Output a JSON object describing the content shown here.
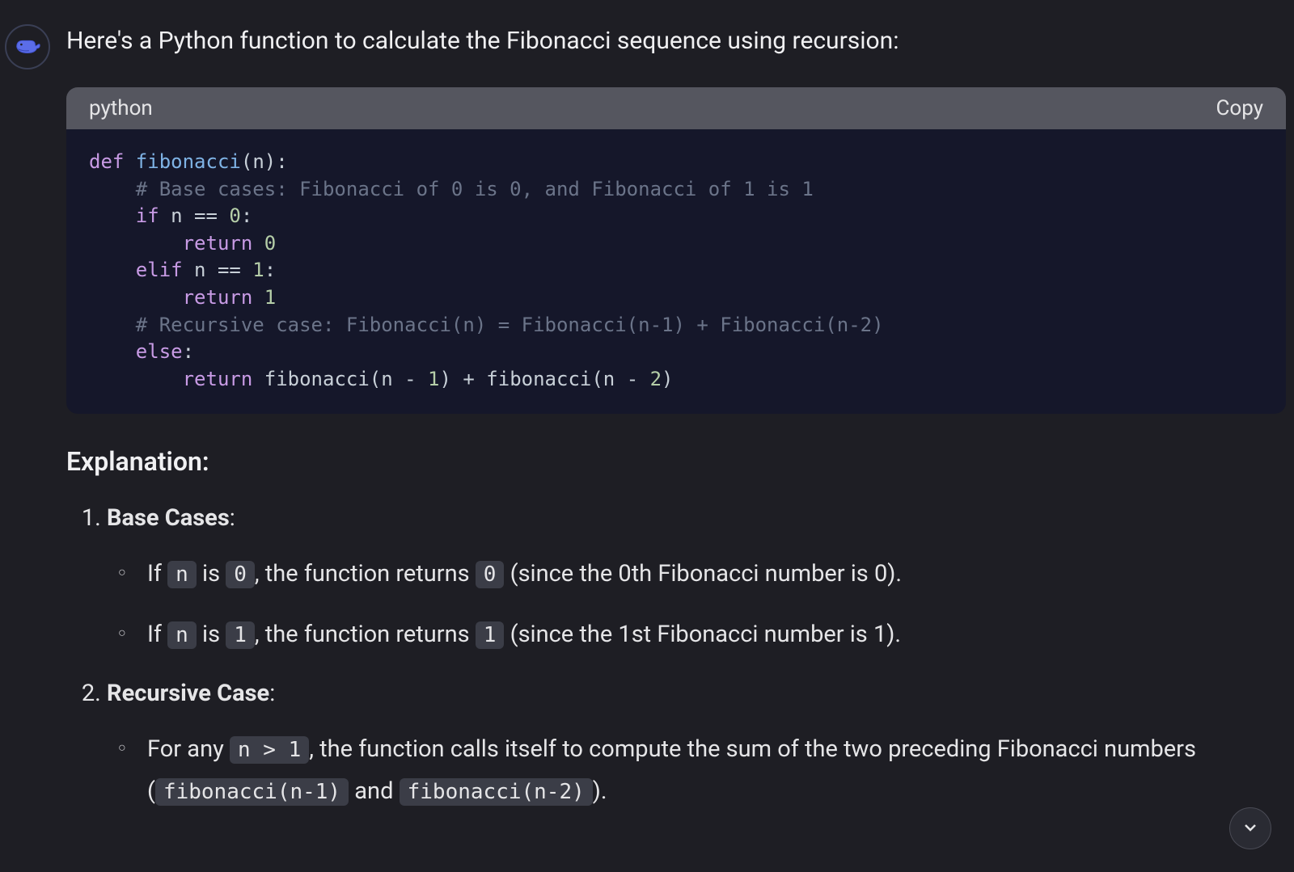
{
  "message": {
    "intro": "Here's a Python function to calculate the Fibonacci sequence using recursion:"
  },
  "code_block": {
    "language": "python",
    "copy_label": "Copy",
    "code": {
      "kw_def": "def",
      "fn_name": " fibonacci",
      "paren_open": "(",
      "param_n": "n",
      "paren_close_colon": "):",
      "indent1": "    ",
      "comment1": "# Base cases: Fibonacci of 0 is 0, and Fibonacci of 1 is 1",
      "kw_if": "if",
      "if_cond": " n == ",
      "zero": "0",
      "colon": ":",
      "indent2": "        ",
      "kw_return": "return",
      "space": " ",
      "kw_elif": "elif",
      "one": "1",
      "comment2": "# Recursive case: Fibonacci(n) = Fibonacci(n-1) + Fibonacci(n-2)",
      "kw_else": "else",
      "rec_call_a": " fibonacci(n - ",
      "rec_mid": ") + fibonacci(n - ",
      "two": "2",
      "rec_end": ")"
    }
  },
  "explanation": {
    "heading": "Explanation:",
    "items": [
      {
        "title": "Base Cases",
        "colon": ":",
        "bullets": [
          {
            "pre1": "If ",
            "code1": "n",
            "mid1": " is ",
            "code2": "0",
            "mid2": ", the function returns ",
            "code3": "0",
            "post": " (since the 0th Fibonacci number is 0)."
          },
          {
            "pre1": "If ",
            "code1": "n",
            "mid1": " is ",
            "code2": "1",
            "mid2": ", the function returns ",
            "code3": "1",
            "post": " (since the 1st Fibonacci number is 1)."
          }
        ]
      },
      {
        "title": "Recursive Case",
        "colon": ":",
        "bullets": [
          {
            "pre1": "For any ",
            "code1": "n > 1",
            "mid1": ", the function calls itself to compute the sum of the two preceding Fibonacci numbers (",
            "code2": "fibonacci(n-1)",
            "mid2": " and ",
            "code3": "fibonacci(n-2)",
            "post": ")."
          }
        ]
      }
    ]
  }
}
